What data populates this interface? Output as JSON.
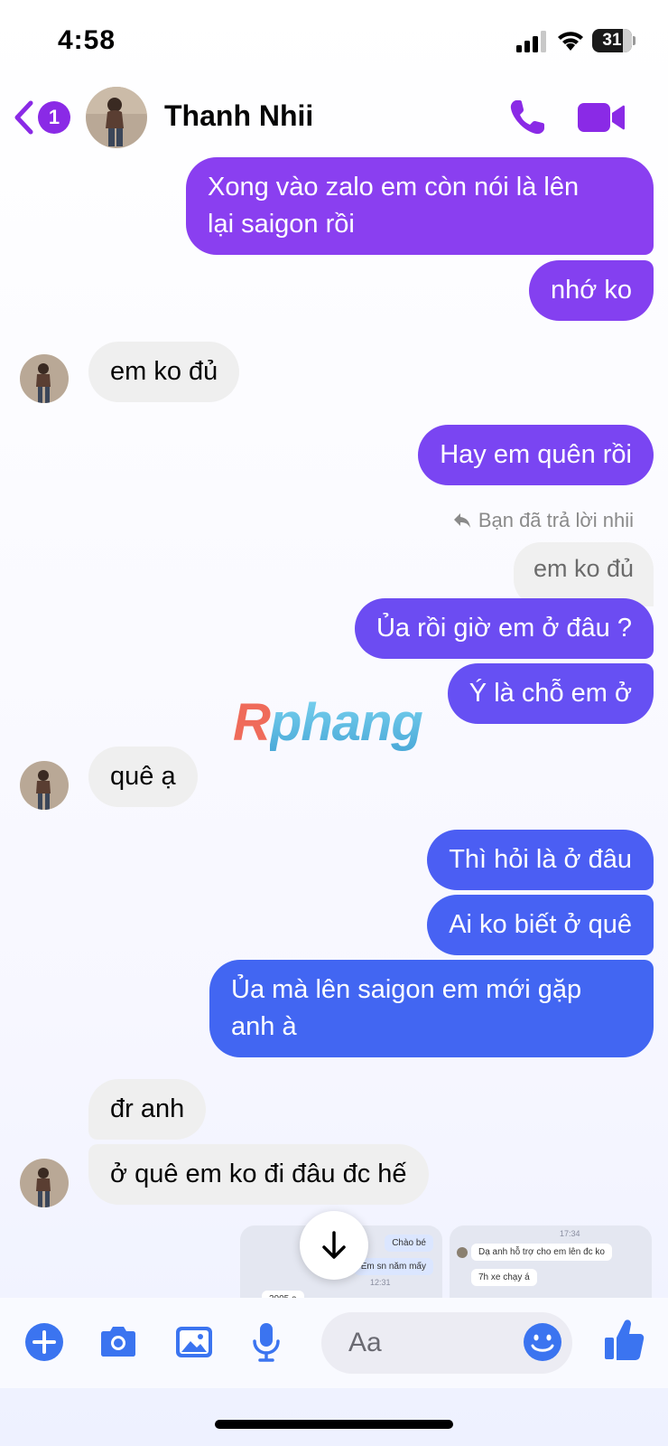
{
  "status_bar": {
    "time": "4:58",
    "battery": "31"
  },
  "header": {
    "unread_count": "1",
    "contact_name": "Thanh Nhii"
  },
  "messages": [
    {
      "text_lines": [
        "Xong vào zalo em còn nói là lên",
        "lại saigon rồi"
      ],
      "direction": "out",
      "color": "#8a3ff0"
    },
    {
      "text": "nhớ ko",
      "direction": "out",
      "color": "#8440f0"
    },
    {
      "text": "em ko đủ",
      "direction": "in"
    },
    {
      "text": "Hay em quên rồi",
      "direction": "out",
      "color": "#7a45f2"
    },
    {
      "text": "Ủa rồi giờ em ở đâu ?",
      "direction": "out",
      "color": "#6c4cf2"
    },
    {
      "text": "Ý là chỗ em ở",
      "direction": "out",
      "color": "#6650f3"
    },
    {
      "text": "quê ạ",
      "direction": "in"
    },
    {
      "text": "Thì hỏi là ở đâu",
      "direction": "out",
      "color": "#4b5ef3"
    },
    {
      "text": "Ai ko biết ở quê",
      "direction": "out",
      "color": "#4762f3"
    },
    {
      "text_lines": [
        "Ủa mà lên saigon em mới gặp",
        "anh à"
      ],
      "direction": "out",
      "color": "#4266f2"
    },
    {
      "text": "đr anh",
      "direction": "in"
    },
    {
      "text": "ở quê em ko đi đâu đc hế",
      "direction": "in"
    }
  ],
  "reply": {
    "note": "Bạn đã trả lời nhii",
    "quoted_text": "em ko đủ"
  },
  "watermark": {
    "first": "R",
    "rest": "phang"
  },
  "thumbnails": [
    {
      "bubbles": [
        "Chào bé",
        "Em sn năm mấy"
      ],
      "time": "12:31",
      "left_text": "2005 ạ"
    },
    {
      "time": "17:34",
      "bubbles": [
        "Dạ anh hỗ trợ cho em lên đc ko",
        "7h xe chạy á"
      ]
    }
  ],
  "composer": {
    "placeholder": "Aa"
  },
  "colors": {
    "accent": "#8a2ae6",
    "composer_icons": "#3b74f0",
    "incoming_bg": "#efefef"
  },
  "icons": [
    "chevron-left-icon",
    "phone-icon",
    "video-camera-icon",
    "plus-icon",
    "camera-icon",
    "image-icon",
    "microphone-icon",
    "emoji-icon",
    "thumbs-up-icon",
    "arrow-down-icon",
    "reply-icon"
  ]
}
